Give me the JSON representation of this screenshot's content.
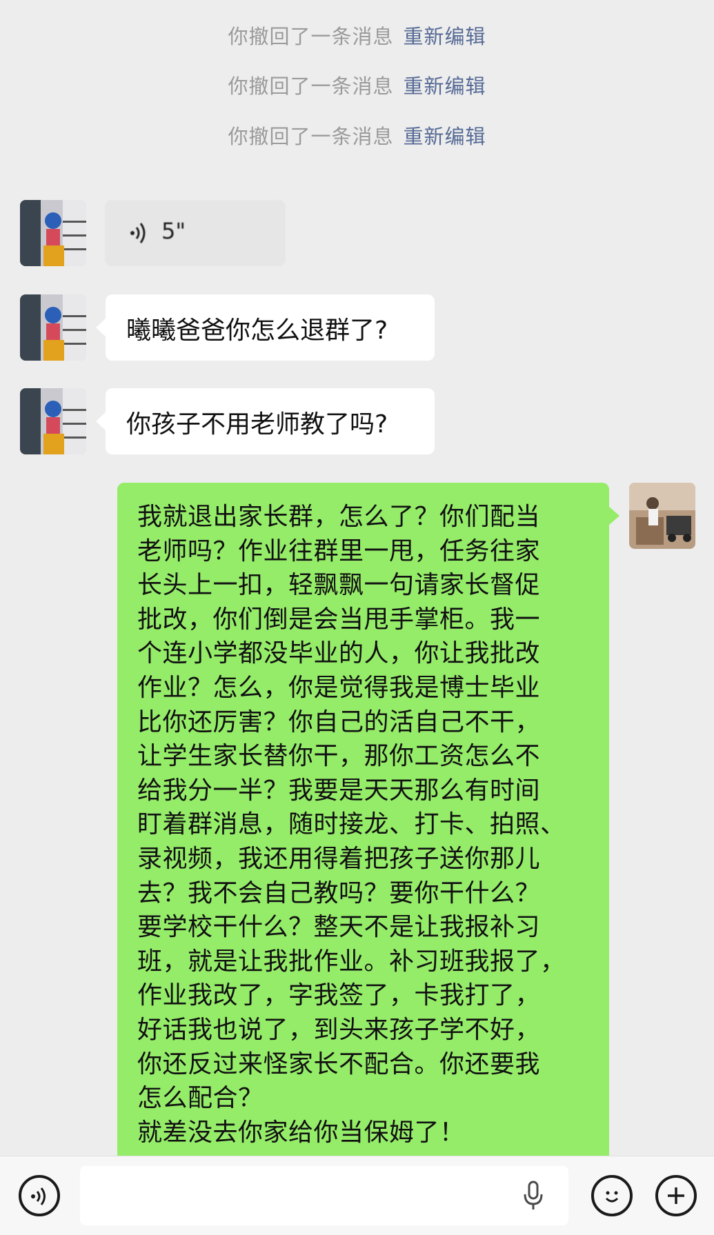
{
  "system_notices": [
    {
      "text": "你撤回了一条消息",
      "action": "重新编辑"
    },
    {
      "text": "你撤回了一条消息",
      "action": "重新编辑"
    },
    {
      "text": "你撤回了一条消息",
      "action": "重新编辑"
    }
  ],
  "messages": {
    "voice_duration": "5\"",
    "incoming_1": "曦曦爸爸你怎么退群了?",
    "incoming_2": "你孩子不用老师教了吗?",
    "outgoing_lines": [
      "我就退出家长群，怎么了？你们配当",
      "老师吗？作业往群里一甩，任务往家",
      "长头上一扣，轻飘飘一句请家长督促",
      "批改，你们倒是会当甩手掌柜。我一",
      "个连小学都没毕业的人，你让我批改",
      "作业？怎么，你是觉得我是博士毕业",
      "比你还厉害？你自己的活自己不干，",
      "让学生家长替你干，那你工资怎么不",
      "给我分一半？我要是天天那么有时间",
      "盯着群消息，随时接龙、打卡、拍照、",
      "录视频，我还用得着把孩子送你那儿",
      "去？我不会自己教吗？要你干什么？",
      "要学校干什么？整天不是让我报补习",
      "班，就是让我批作业。补习班我报了，",
      "作业我改了，字我签了，卡我打了，",
      "好话我也说了，到头来孩子学不好，",
      "你还反过来怪家长不配合。你还要我",
      "怎么配合？",
      "就差没去你家给你当保姆了！"
    ]
  },
  "icons": {
    "voice_toggle": "voice-mode-icon",
    "mic": "microphone-icon",
    "emoji": "emoji-icon",
    "more": "plus-icon"
  },
  "colors": {
    "background": "#ededed",
    "outgoing_bubble": "#95ec69",
    "incoming_bubble": "#ffffff",
    "link": "#576b95",
    "system_text": "#9a9a9a"
  }
}
